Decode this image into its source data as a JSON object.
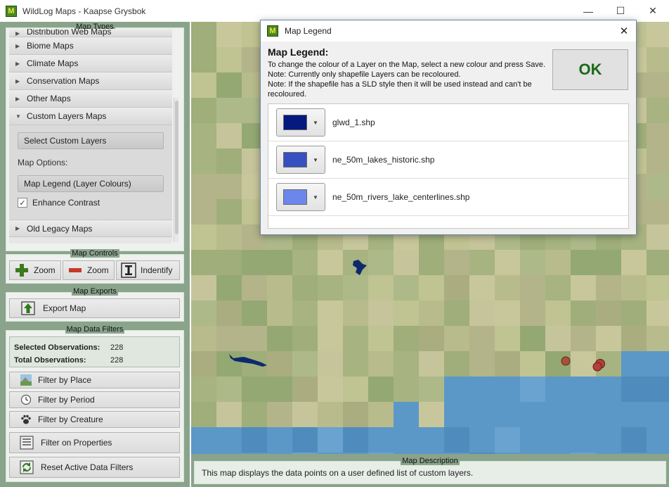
{
  "window": {
    "title": "WildLog Maps - Kaapse Grysbok",
    "minimize": "—",
    "maximize": "☐",
    "close": "✕",
    "app_icon_letter": "M"
  },
  "map_types": {
    "title": "Map Types",
    "items": [
      "Distribution Web Maps",
      "Biome Maps",
      "Climate Maps",
      "Conservation Maps",
      "Other Maps",
      "Custom Layers Maps"
    ],
    "expanded_item": "Custom Layers Maps",
    "select_custom_layers": "Select Custom Layers",
    "map_options_label": "Map Options:",
    "map_legend_button": "Map Legend (Layer Colours)",
    "enhance_contrast": {
      "label": "Enhance Contrast",
      "checked": true
    },
    "last_item": "Old Legacy Maps"
  },
  "map_controls": {
    "title": "Map Controls",
    "zoom_in": "Zoom",
    "zoom_out": "Zoom",
    "identify": "Indentify"
  },
  "map_exports": {
    "title": "Map Exports",
    "export_map": "Export Map"
  },
  "data_filters": {
    "title": "Map Data Filters",
    "selected_label": "Selected Observations:",
    "selected_value": "228",
    "total_label": "Total Observations:",
    "total_value": "228",
    "filter_place": "Filter by Place",
    "filter_period": "Filter by Period",
    "filter_creature": "Filter by Creature",
    "filter_properties": "Filter on Properties",
    "reset_filters": "Reset Active Data Filters"
  },
  "description": {
    "title": "Map Description",
    "text": "This map displays the data points on a user defined list of custom layers."
  },
  "dialog": {
    "title": "Map Legend",
    "heading": "Map Legend:",
    "text_line1": "To change the colour of a Layer on the Map, select a new colour and press Save.",
    "text_line2": "Note: Currently only shapefile Layers can be recoloured.",
    "text_line3": "Note: If the shapefile has a SLD style then it will be used instead and can't be recoloured.",
    "ok": "OK",
    "layers": [
      {
        "name": "glwd_1.shp",
        "color": "#041a7e"
      },
      {
        "name": "ne_50m_lakes_historic.shp",
        "color": "#3650bf"
      },
      {
        "name": "ne_50m_rivers_lake_centerlines.shp",
        "color": "#6c87ec"
      }
    ]
  },
  "colors": {
    "panel_bg": "#8aa48c",
    "ocean": "#5b98c8",
    "ok_text": "#1a6a1a"
  }
}
